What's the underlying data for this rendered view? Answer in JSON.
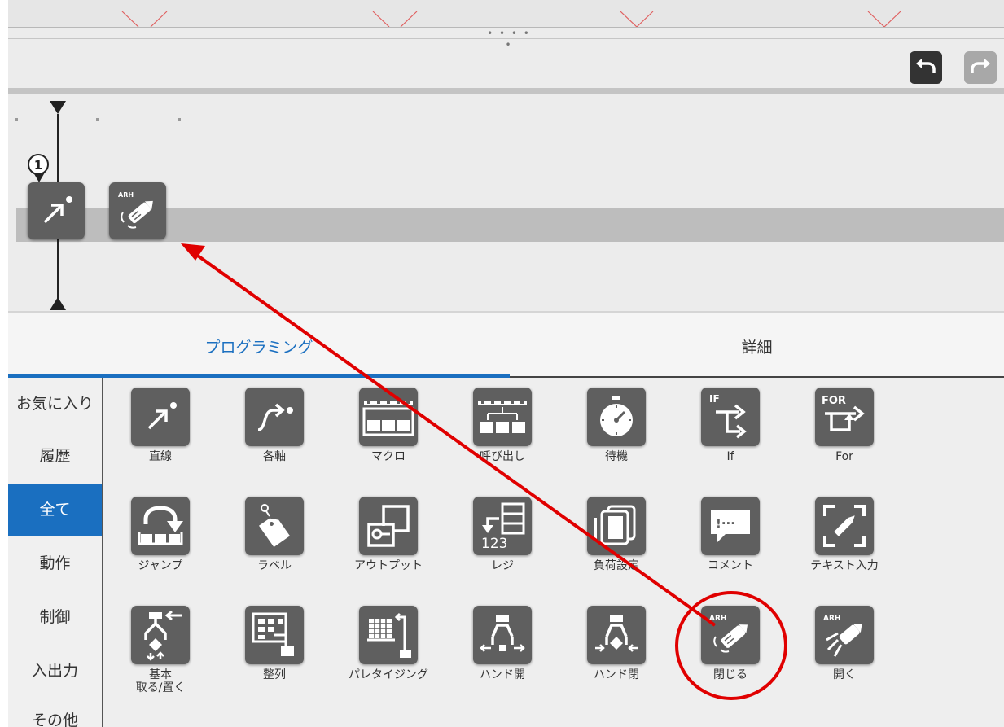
{
  "toolbar": {
    "handle": "• • • • •"
  },
  "timeline": {
    "step_number": "1"
  },
  "tabs": [
    {
      "label": "プログラミング",
      "active": true
    },
    {
      "label": "詳細",
      "active": false
    }
  ],
  "categories": [
    {
      "label": "お気に入り"
    },
    {
      "label": "履歴"
    },
    {
      "label": "全て",
      "active": true
    },
    {
      "label": "動作"
    },
    {
      "label": "制御"
    },
    {
      "label": "入出力"
    },
    {
      "label": "その他"
    }
  ],
  "commands": [
    {
      "label": "直線",
      "icon": "linear-move-icon"
    },
    {
      "label": "各軸",
      "icon": "joint-move-icon"
    },
    {
      "label": "マクロ",
      "icon": "macro-icon"
    },
    {
      "label": "呼び出し",
      "icon": "call-icon"
    },
    {
      "label": "待機",
      "icon": "wait-stopwatch-icon"
    },
    {
      "label": "If",
      "icon": "if-icon"
    },
    {
      "label": "For",
      "icon": "for-icon"
    },
    {
      "label": "ジャンプ",
      "icon": "jump-icon"
    },
    {
      "label": "ラベル",
      "icon": "label-tag-icon"
    },
    {
      "label": "アウトプット",
      "icon": "output-icon"
    },
    {
      "label": "レジ",
      "icon": "register-icon"
    },
    {
      "label": "負荷設定",
      "icon": "payload-icon"
    },
    {
      "label": "コメント",
      "icon": "comment-icon"
    },
    {
      "label": "テキスト入力",
      "icon": "text-input-icon"
    },
    {
      "label": "基本\n取る/置く",
      "icon": "pick-place-icon"
    },
    {
      "label": "整列",
      "icon": "align-icon"
    },
    {
      "label": "パレタイジング",
      "icon": "palletizing-icon"
    },
    {
      "label": "ハンド開",
      "icon": "hand-open-icon"
    },
    {
      "label": "ハンド閉",
      "icon": "hand-close-icon"
    },
    {
      "label": "閉じる",
      "icon": "arh-close-icon"
    },
    {
      "label": "開く",
      "icon": "arh-open-icon"
    }
  ],
  "icon_text": {
    "arh": "ARH",
    "if": "IF",
    "for": "FOR",
    "num": "123",
    "dots": "!···"
  },
  "colors": {
    "accent": "#1a6fc0",
    "icon_bg": "#5f5f5f",
    "annotation": "#e00000"
  }
}
